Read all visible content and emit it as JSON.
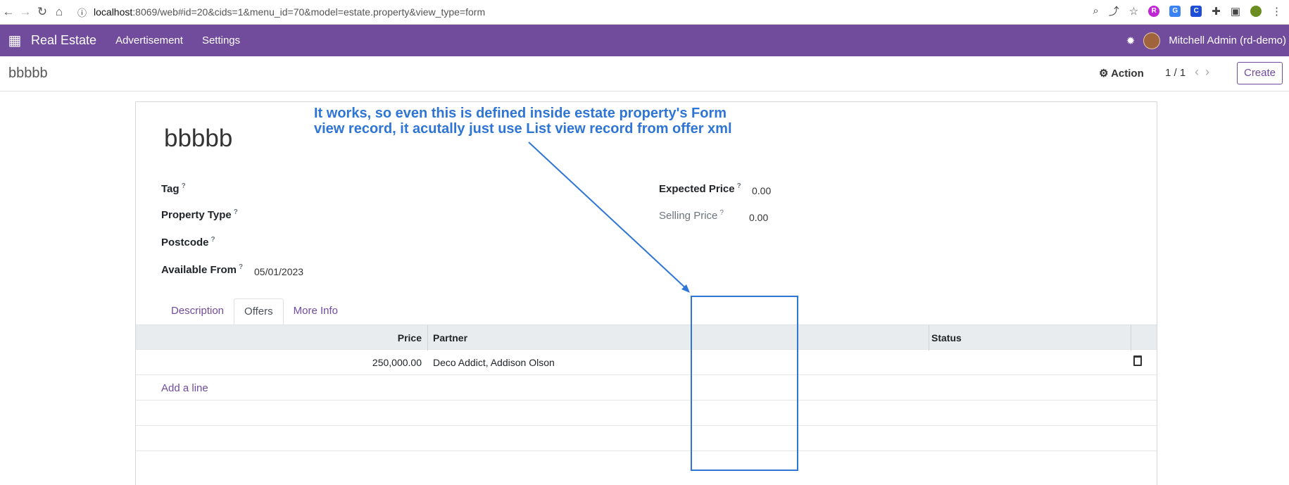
{
  "browser": {
    "url_host": "localhost",
    "url_path": ":8069/web#id=20&cids=1&menu_id=70&model=estate.property&view_type=form"
  },
  "topbar": {
    "brand": "Real Estate",
    "menu": [
      "Advertisement",
      "Settings"
    ],
    "user": "Mitchell Admin (rd-demo)"
  },
  "control": {
    "breadcrumb": "bbbbb",
    "action_label": "Action",
    "pager": "1 / 1",
    "create_label": "Create"
  },
  "record": {
    "name": "bbbbb",
    "fields": {
      "tag": "Tag",
      "property_type": "Property Type",
      "postcode": "Postcode",
      "available_from_label": "Available From",
      "available_from_value": "05/01/2023",
      "expected_price_label": "Expected Price",
      "expected_price_value": "0.00",
      "selling_price_label": "Selling Price",
      "selling_price_value": "0.00"
    },
    "tabs": [
      "Description",
      "Offers",
      "More Info"
    ],
    "offers": {
      "columns": [
        "Price",
        "Partner",
        "Status"
      ],
      "rows": [
        {
          "price": "250,000.00",
          "partner": "Deco Addict, Addison Olson",
          "status": ""
        }
      ],
      "add_line": "Add a line"
    }
  },
  "annotation": {
    "text": "It works, so even this is defined inside estate property's Form view record, it acutally just use List view record from offer xml"
  }
}
